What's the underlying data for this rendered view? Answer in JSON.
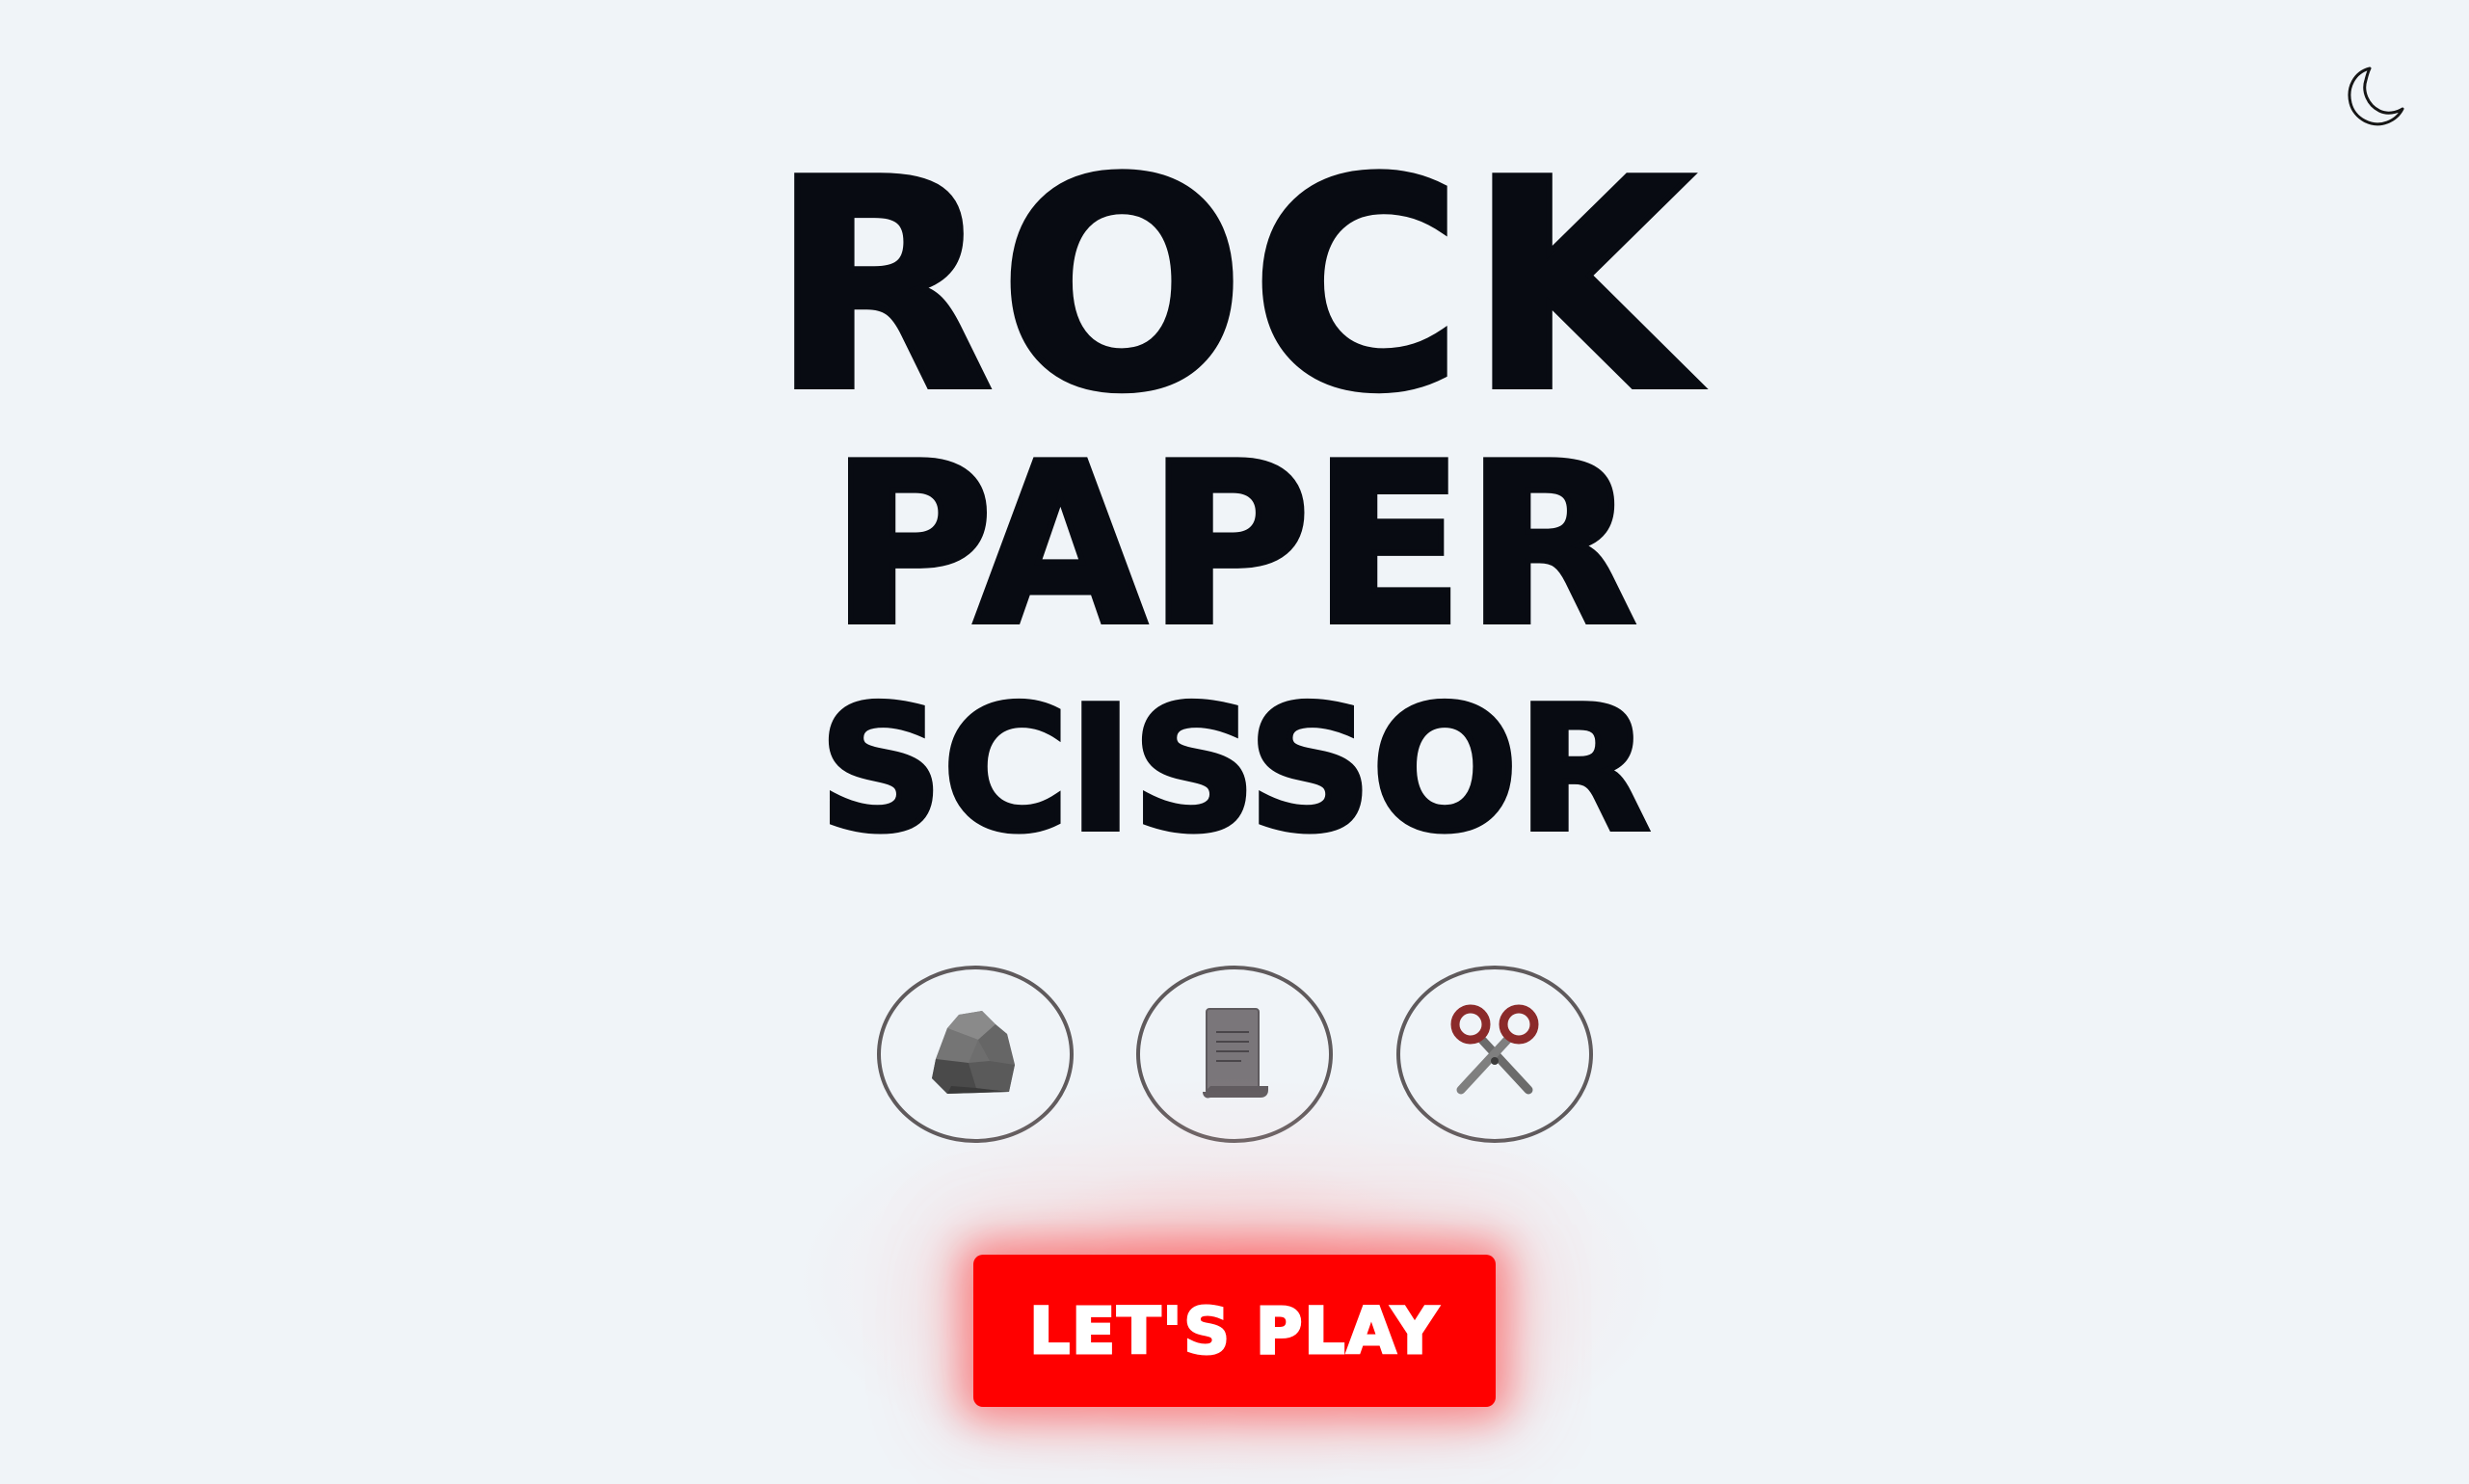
{
  "header": {
    "theme_toggle_icon": "moon-icon"
  },
  "title": {
    "line1": "ROCK",
    "line2": "PAPER",
    "line3": "SCISSOR"
  },
  "choices": [
    {
      "icon": "rock-icon"
    },
    {
      "icon": "paper-icon"
    },
    {
      "icon": "scissors-icon"
    }
  ],
  "play_button": {
    "label": "LET'S PLAY"
  },
  "colors": {
    "background": "#f0f4f8",
    "title": "#080b12",
    "accent": "#ff0000",
    "choice_border": "#5f5a5c",
    "scissors_handle": "#8b2a2a"
  }
}
